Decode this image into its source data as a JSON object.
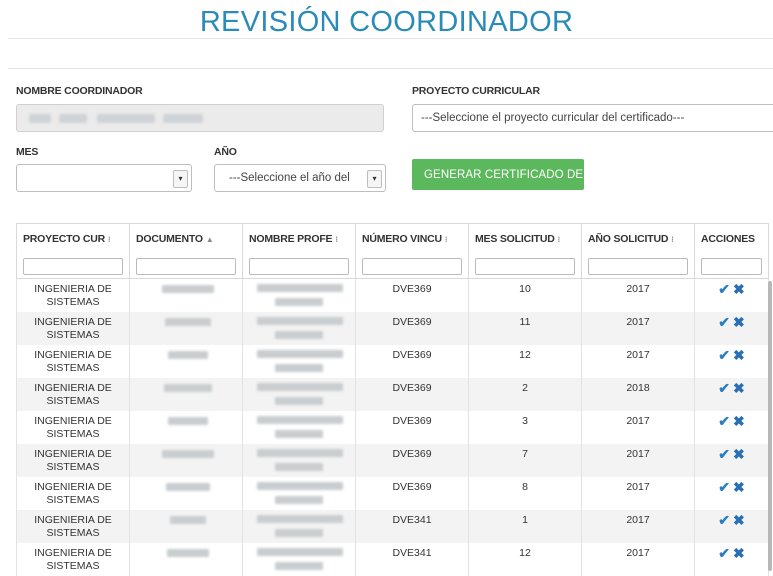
{
  "page": {
    "title": "REVISIÓN COORDINADOR"
  },
  "form": {
    "coordinator_label": "NOMBRE COORDINADOR",
    "project_label": "PROYECTO CURRICULAR",
    "project_select": "---Seleccione el proyecto curricular del certificado---",
    "month_label": "MES",
    "month_select": "",
    "year_label": "AÑO",
    "year_select": "---Seleccione el año del",
    "generate_button": "GENERAR CERTIFICADO DE C"
  },
  "table": {
    "columns": [
      "PROYECTO CUR",
      "DOCUMENTO",
      "NOMBRE PROFE",
      "NÚMERO VINCU",
      "MES SOLICITUD",
      "AÑO SOLICITUD",
      "ACCIONES"
    ],
    "rows": [
      {
        "project": "INGENIERIA DE SISTEMAS",
        "vinculo": "DVE369",
        "mes": "10",
        "anio": "2017"
      },
      {
        "project": "INGENIERIA DE SISTEMAS",
        "vinculo": "DVE369",
        "mes": "11",
        "anio": "2017"
      },
      {
        "project": "INGENIERIA DE SISTEMAS",
        "vinculo": "DVE369",
        "mes": "12",
        "anio": "2017"
      },
      {
        "project": "INGENIERIA DE SISTEMAS",
        "vinculo": "DVE369",
        "mes": "2",
        "anio": "2018"
      },
      {
        "project": "INGENIERIA DE SISTEMAS",
        "vinculo": "DVE369",
        "mes": "3",
        "anio": "2017"
      },
      {
        "project": "INGENIERIA DE SISTEMAS",
        "vinculo": "DVE369",
        "mes": "7",
        "anio": "2017"
      },
      {
        "project": "INGENIERIA DE SISTEMAS",
        "vinculo": "DVE369",
        "mes": "8",
        "anio": "2017"
      },
      {
        "project": "INGENIERIA DE SISTEMAS",
        "vinculo": "DVE341",
        "mes": "1",
        "anio": "2017"
      },
      {
        "project": "INGENIERIA DE SISTEMAS",
        "vinculo": "DVE341",
        "mes": "12",
        "anio": "2017"
      }
    ],
    "actions": {
      "approve_icon": "check-icon",
      "reject_icon": "x-icon"
    }
  },
  "colors": {
    "title": "#2a8ab8",
    "button": "#5cb85c",
    "action": "#2a7fc0"
  }
}
